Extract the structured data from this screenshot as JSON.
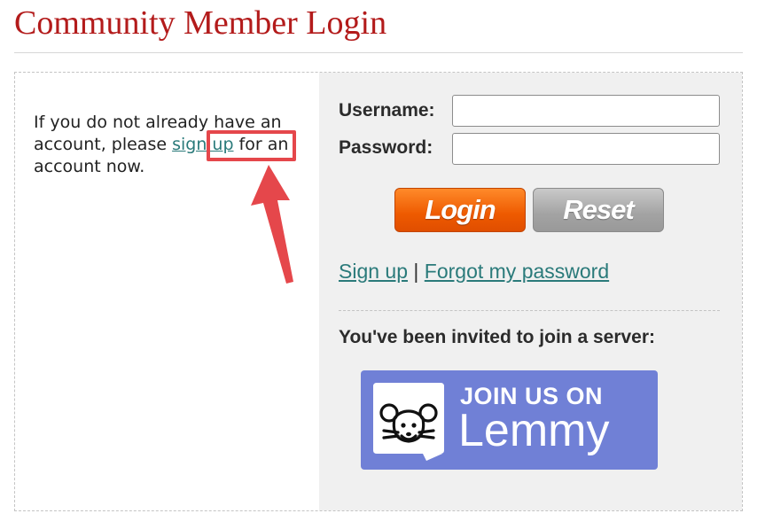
{
  "page": {
    "title": "Community Member Login"
  },
  "left": {
    "intro_before": "If you do not already have an account, please ",
    "signup_link": "sign up",
    "intro_after": " for an account now."
  },
  "form": {
    "username_label": "Username:",
    "username_value": "",
    "password_label": "Password:",
    "password_value": "",
    "login_button": "Login",
    "reset_button": "Reset"
  },
  "links": {
    "signup": "Sign up",
    "separator": "|",
    "forgot": "Forgot my password"
  },
  "invite": {
    "heading": "You've been invited to join a server:",
    "banner_line1": "JOIN US ON",
    "banner_line2": "Lemmy"
  },
  "colors": {
    "title": "#b31b1b",
    "link": "#2a7a7a",
    "login_button": "#ee5a00",
    "reset_button": "#a3a3a3",
    "banner": "#7080d6",
    "highlight": "#e5474b"
  },
  "icons": {
    "banner_icon": "lemmy-mouse-icon",
    "annotation": "red-arrow-icon"
  }
}
